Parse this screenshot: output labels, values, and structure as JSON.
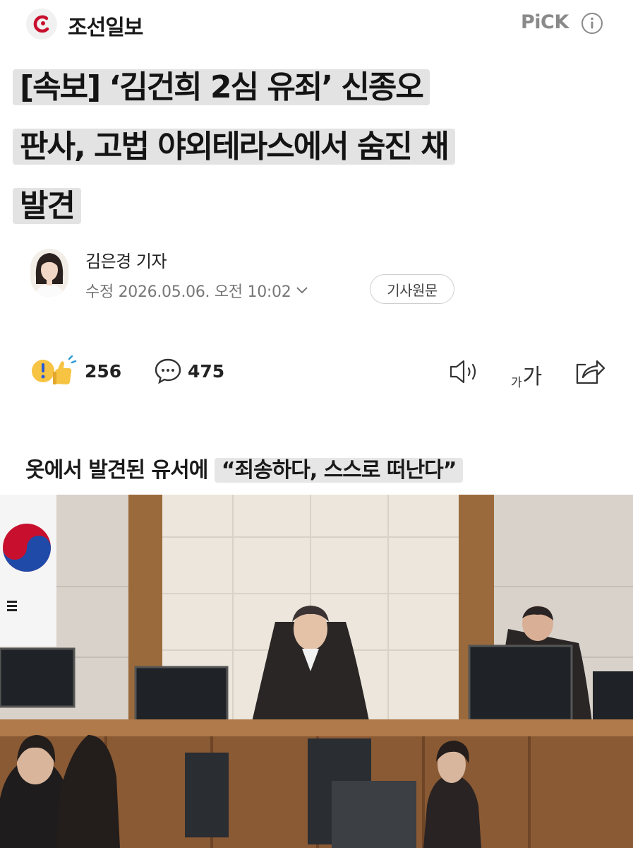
{
  "header": {
    "press_name": "조선일보",
    "pick_label": "PiCK",
    "logo_icon": "chosun-logo-icon",
    "info_icon": "info-icon"
  },
  "article": {
    "headline_lines": [
      "[속보] ‘김건희 2심 유죄’ 신종오",
      "판사, 고법 야외테라스에서 숨진 채",
      "발견"
    ],
    "reporter": "김은경 기자",
    "date": "수정 2026.05.06. 오전 10:02",
    "original_button": "기사원문",
    "subheading": {
      "prefix": "옷에서 발견된 유서에 ",
      "quote": "“죄송하다, 스스로 떠난다”"
    }
  },
  "actions": {
    "reactions_count": "256",
    "comments_count": "475",
    "font_size_label_small": "가",
    "font_size_label_large": "가"
  },
  "colors": {
    "brand_red": "#c8102e",
    "highlight": "#e3e3e3",
    "muted_text": "#777777"
  }
}
